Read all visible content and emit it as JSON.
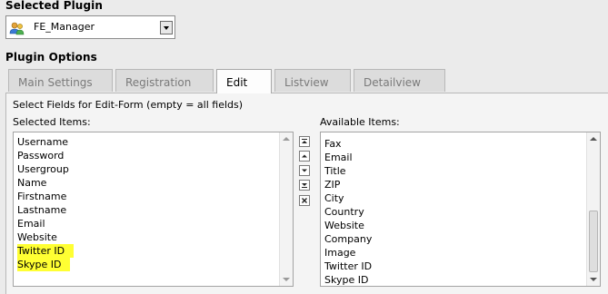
{
  "selected_plugin": {
    "heading": "Selected Plugin",
    "value": "FE_Manager",
    "icon": "users-icon"
  },
  "plugin_options": {
    "heading": "Plugin Options",
    "tabs": [
      {
        "label": "Main Settings",
        "active": false
      },
      {
        "label": "Registration",
        "active": false
      },
      {
        "label": "Edit",
        "active": true
      },
      {
        "label": "Listview",
        "active": false
      },
      {
        "label": "Detailview",
        "active": false
      }
    ]
  },
  "edit_form": {
    "field_caption": "Select Fields for Edit-Form (empty = all fields)",
    "selected_label": "Selected Items:",
    "available_label": "Available Items:",
    "selected_items": [
      "Username",
      "Password",
      "Usergroup",
      "Name",
      "Firstname",
      "Lastname",
      "Email",
      "Website",
      "Twitter ID",
      "Skype ID"
    ],
    "highlighted_items": [
      "Twitter ID",
      "Skype ID"
    ],
    "highlight_color": "#ffff33",
    "available_items": [
      "Fax",
      "Email",
      "Title",
      "ZIP",
      "City",
      "Country",
      "Website",
      "Company",
      "Image",
      "Twitter ID",
      "Skype ID"
    ],
    "controls": [
      "move-top-icon",
      "move-up-icon",
      "move-down-icon",
      "move-bottom-icon",
      "remove-icon"
    ]
  }
}
